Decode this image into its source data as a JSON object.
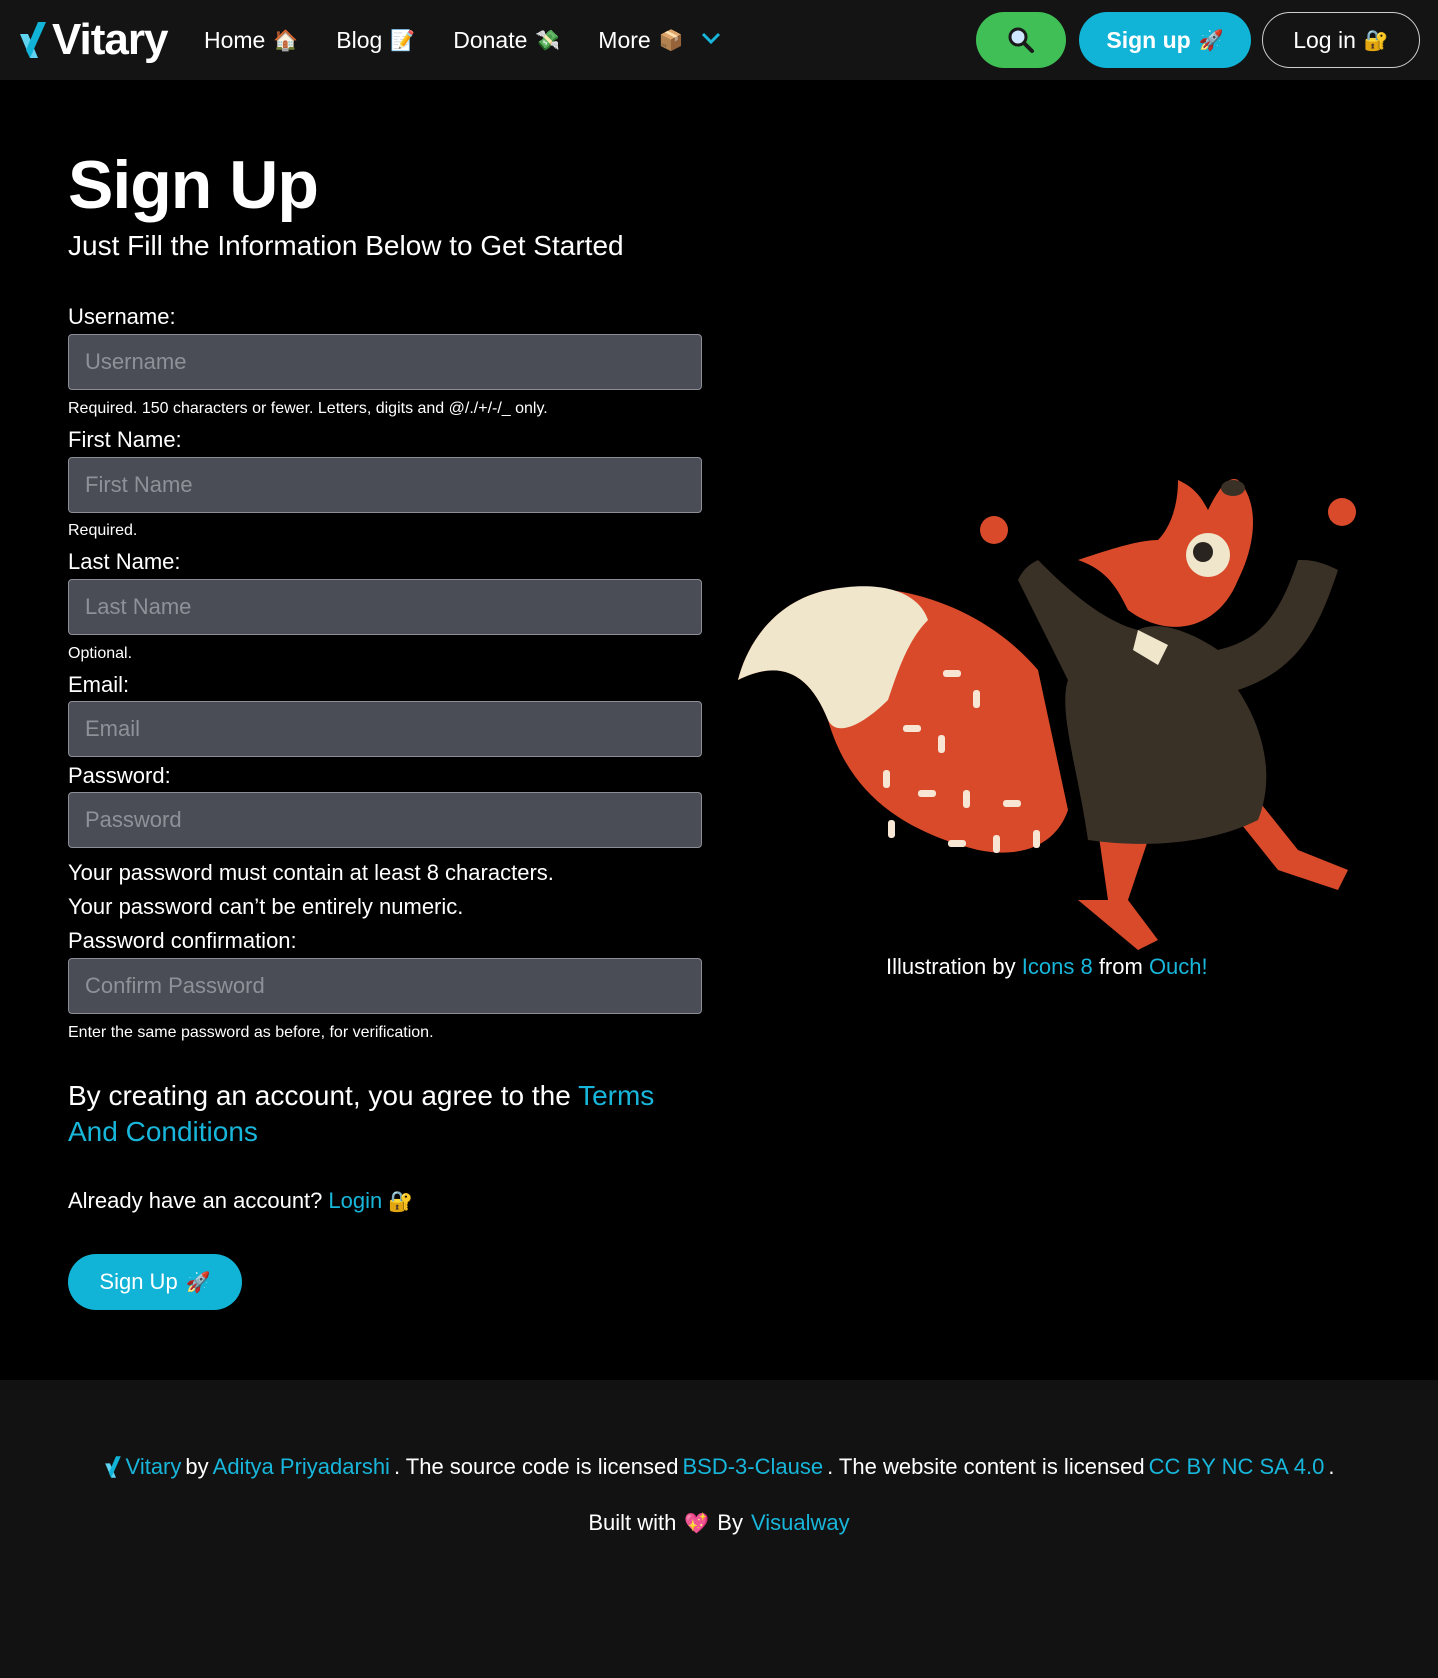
{
  "nav": {
    "brand": "Vitary",
    "links": [
      {
        "label": "Home",
        "emoji": "🏠"
      },
      {
        "label": "Blog",
        "emoji": "📝"
      },
      {
        "label": "Donate",
        "emoji": "💸"
      },
      {
        "label": "More",
        "emoji": "📦"
      }
    ],
    "signup_label": "Sign up",
    "signup_emoji": "🚀",
    "login_label": "Log in",
    "login_emoji": "🔐"
  },
  "form": {
    "title": "Sign Up",
    "subtitle": "Just Fill the Information Below to Get Started",
    "fields": [
      {
        "label": "Username:",
        "placeholder": "Username",
        "help": "Required. 150 characters or fewer. Letters, digits and @/./+/-/_ only."
      },
      {
        "label": "First Name:",
        "placeholder": "First Name",
        "help": "Required."
      },
      {
        "label": "Last Name:",
        "placeholder": "Last Name",
        "help": "Optional."
      },
      {
        "label": "Email:",
        "placeholder": "Email"
      },
      {
        "label": "Password:",
        "placeholder": "Password"
      },
      {
        "label": "Password confirmation:",
        "placeholder": "Confirm Password",
        "help": "Enter the same password as before, for verification."
      }
    ],
    "password_notes": [
      "Your password must contain at least 8 characters.",
      "Your password can’t be entirely numeric."
    ],
    "agree_text": "By creating an account, you agree to the",
    "terms_link": "Terms And Conditions",
    "already_text": "Already have an account?",
    "login_link": "Login",
    "login_emoji": "🔐",
    "submit_label": "Sign Up",
    "submit_emoji": "🚀"
  },
  "illustration": {
    "credit_prefix": "Illustration by",
    "credit_link1": "Icons 8",
    "credit_mid": "from",
    "credit_link2": "Ouch!"
  },
  "footer": {
    "brand_link": "Vitary",
    "by": "by",
    "author_link": "Aditya Priyadarshi",
    "source_text": ". The source code is licensed",
    "license1_link": "BSD-3-Clause",
    "content_text": ". The website content is licensed",
    "license2_link": "CC BY NC SA 4.0",
    "end": ".",
    "built_with": "Built with",
    "heart": "💖",
    "built_by": "By",
    "visualway_link": "Visualway"
  },
  "colors": {
    "accent": "#11b4d6",
    "search_button": "#3fbf55",
    "background": "#000000",
    "navbar": "#141414",
    "footer": "#121212",
    "input_bg": "#4a4d56"
  }
}
